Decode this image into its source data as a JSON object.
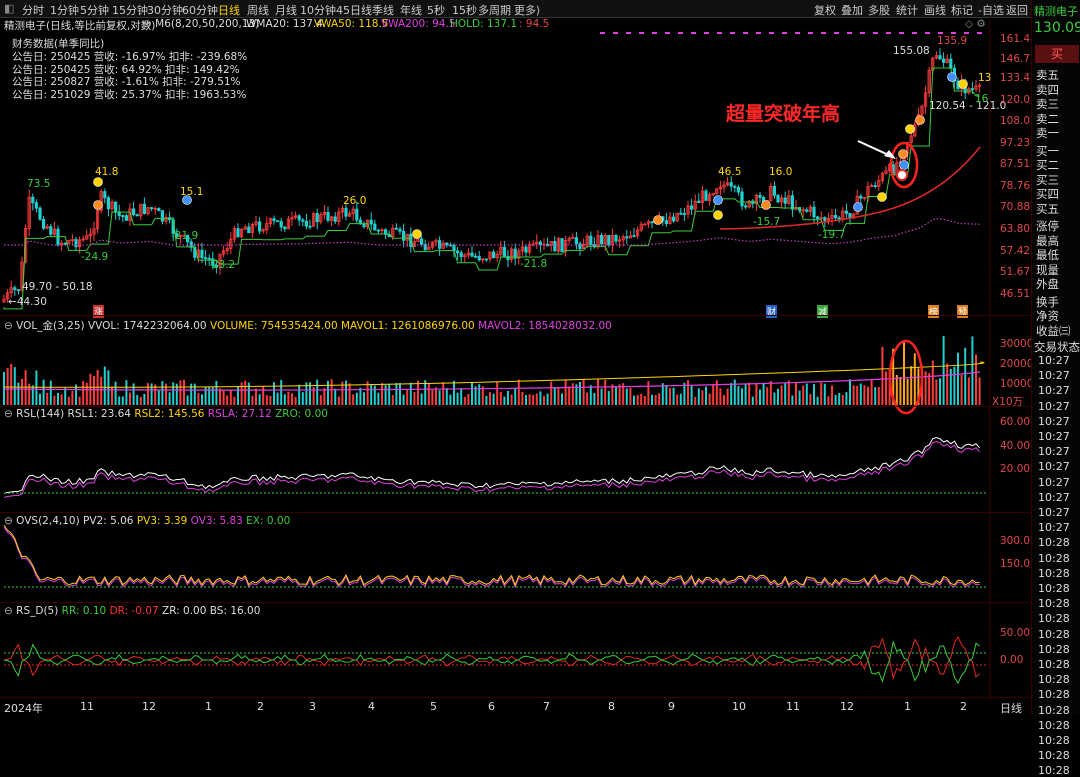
{
  "toolbar": {
    "periods": [
      "分时",
      "1分钟",
      "5分钟",
      "15分钟",
      "30分钟",
      "60分钟",
      "日线",
      "周线",
      "月线",
      "10分钟",
      "45日线",
      "季线",
      "年线",
      "5秒",
      "15秒",
      "多周期",
      "更多⟩"
    ],
    "active_period": "日线",
    "right": [
      "复权",
      "叠加",
      "多股",
      "统计",
      "画线",
      "标记",
      "-自选",
      "返回"
    ]
  },
  "header": {
    "stock_title": "精测电子(日线,等比前复权,对数)",
    "m6": "M6(8,20,50,200,13)",
    "wma20": "WMA20: 137.4",
    "vwa50": "VWA50: 118.5",
    "vwa200": "VWA200: 94.5",
    "hold": "HOLD: 137.1",
    "hold2": "94.5"
  },
  "finance": {
    "title": "财务数据(单季同比)",
    "rows": [
      "公告日: 250425  营收: -16.97%  扣非: -239.68%",
      "公告日: 250425  营收: 64.92%  扣非: 149.42%",
      "公告日: 250827  营收: -1.61%  扣非: -279.51%",
      "公告日: 251029  营收: 25.37%  扣非: 1963.53%"
    ]
  },
  "annotation": "超量突破年高",
  "price_axis": [
    "161.4",
    "146.7",
    "133.4",
    "120.0",
    "108.0",
    "97.23",
    "87.51",
    "78.76",
    "70.88",
    "63.80",
    "57.42",
    "51.67",
    "46.51"
  ],
  "price_labels": {
    "p155": "155.08",
    "p1359": "135.9",
    "p120": "120.54 - 121.0",
    "p73": "73.5",
    "p418": "41.8",
    "p151": "15.1",
    "p260": "26.0",
    "p465": "46.5",
    "p160": "16.0",
    "n249": "-24.9",
    "n219": "-21.9",
    "n232": "-23.2",
    "n218": "-21.8",
    "n157": "-15.7",
    "n197": "-19.7",
    "low": "49.70 - 50.18",
    "low2": "44.30",
    "r13": "13",
    "r16": "16"
  },
  "tags": {
    "zhang": "涨",
    "cai": "财",
    "jian": "减",
    "bang": "榜",
    "yu": "预"
  },
  "vol": {
    "title": "VOL_金(3,25)",
    "vvol": "VVOL: 1742232064.00",
    "volume": "VOLUME: 754535424.00",
    "mavol1": "MAVOL1: 1261086976.00",
    "mavol2": "MAVOL2: 1854028032.00",
    "axis": [
      "30000",
      "20000",
      "10000"
    ],
    "unit": "X10万"
  },
  "rsl": {
    "title": "RSL(144)",
    "rsl1": "RSL1: 23.64",
    "rsl2": "RSL2: 145.56",
    "rsla": "RSLA: 27.12",
    "zro": "ZRO: 0.00",
    "axis": [
      "60.00",
      "40.00",
      "20.00"
    ]
  },
  "ovs": {
    "title": "OVS(2,4,10)",
    "pv2": "PV2: 5.06",
    "pv3": "PV3: 3.39",
    "ov3": "OV3: 5.83",
    "ex": "EX: 0.00",
    "axis": [
      "300.0",
      "150.0"
    ]
  },
  "rsd": {
    "title": "RS_D(5)",
    "rr": "RR: 0.10",
    "dr": "DR: -0.07",
    "zr": "ZR: 0.00",
    "bs": "BS: 16.00",
    "axis": [
      "50.00",
      "0.00"
    ]
  },
  "dates": [
    "2024年",
    "11",
    "12",
    "1",
    "2",
    "3",
    "4",
    "5",
    "6",
    "7",
    "8",
    "9",
    "10",
    "11",
    "12",
    "1",
    "2"
  ],
  "date_right": "日线",
  "rightpanel": {
    "name": "精测电子",
    "price": "130.09",
    "buy_btn": "买",
    "sells": [
      "卖五",
      "卖四",
      "卖三",
      "卖二",
      "卖一"
    ],
    "buys": [
      "买一",
      "买二",
      "买三",
      "买四",
      "买五"
    ],
    "stats": [
      "涨停",
      "最高",
      "最低",
      "现量",
      "外盘"
    ],
    "extra": [
      "换手",
      "净资",
      "收益㈢"
    ],
    "trade_status": "交易状态",
    "times": [
      "10:27",
      "10:27",
      "10:27",
      "10:27",
      "10:27",
      "10:27",
      "10:27",
      "10:27",
      "10:27",
      "10:27",
      "10:27",
      "10:27",
      "10:28",
      "10:28",
      "10:28",
      "10:28",
      "10:28",
      "10:28",
      "10:28",
      "10:28",
      "10:28",
      "10:28",
      "10:28",
      "10:28",
      "10:28",
      "10:28",
      "10:28",
      "10:28"
    ]
  }
}
